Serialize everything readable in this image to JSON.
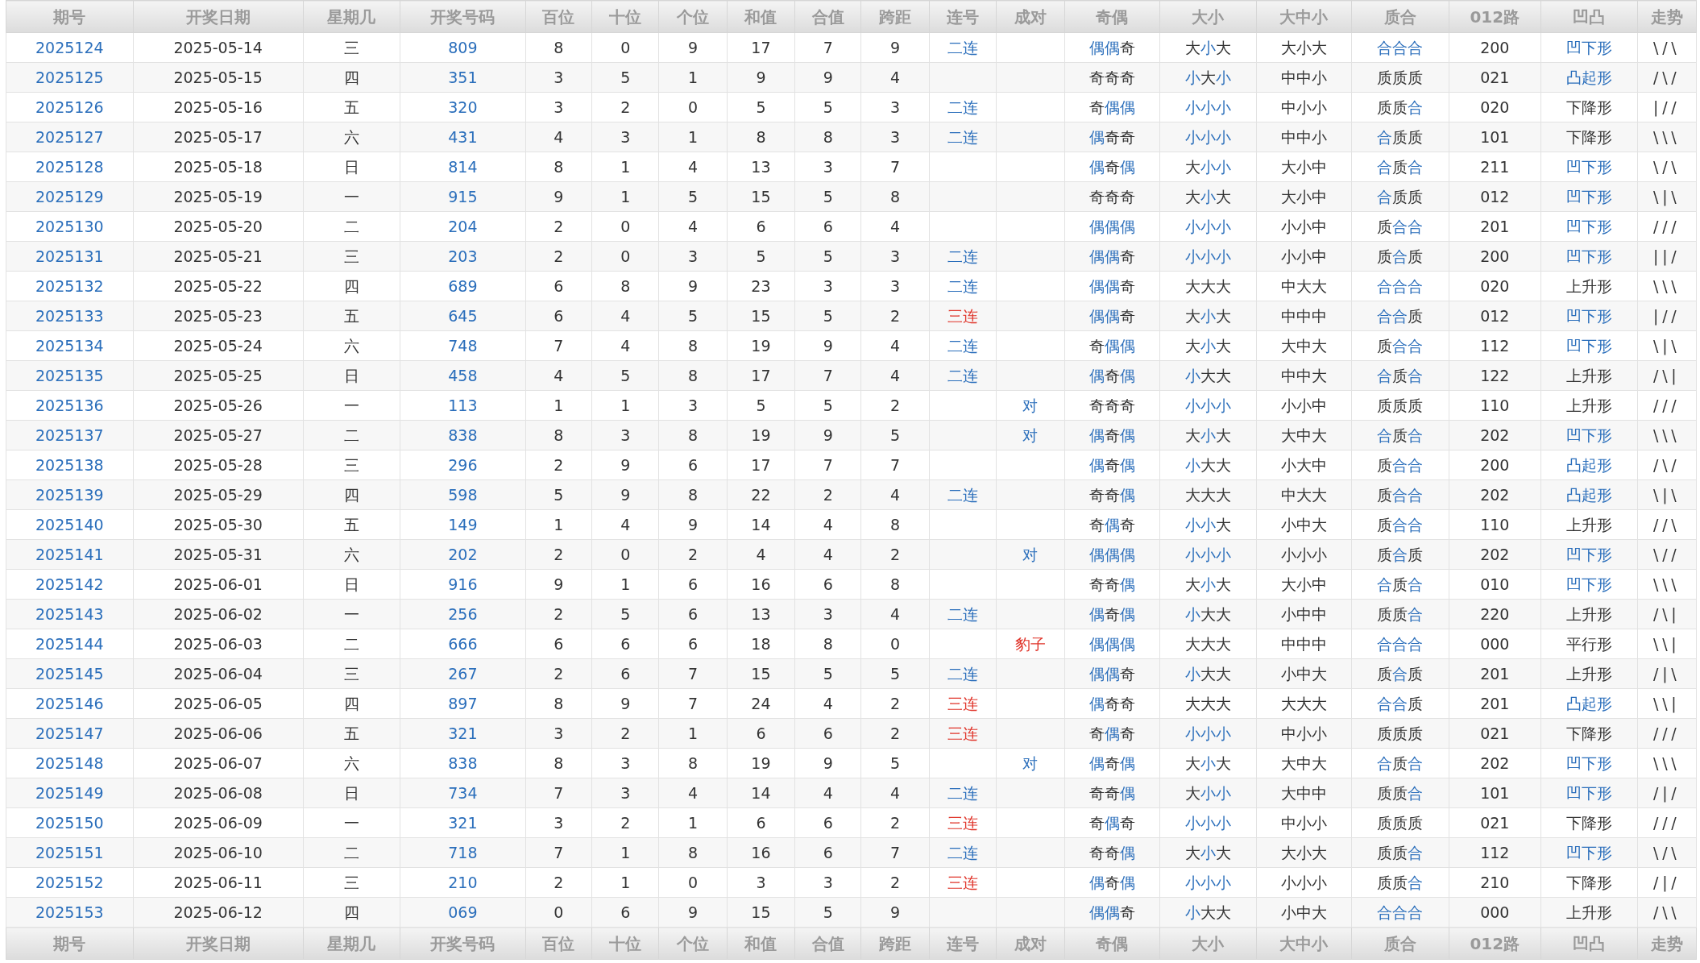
{
  "columns": [
    "期号",
    "开奖日期",
    "星期几",
    "开奖号码",
    "百位",
    "十位",
    "个位",
    "和值",
    "合值",
    "跨距",
    "连号",
    "成对",
    "奇偶",
    "大小",
    "大中小",
    "质合",
    "012路",
    "凹凸",
    "走势"
  ],
  "rows": [
    {
      "issue": "2025124",
      "date": "2025-05-14",
      "weekday": "三",
      "number": "809",
      "hundreds": "8",
      "tens": "0",
      "units": "9",
      "sum": "17",
      "sum_tail": "7",
      "span": "9",
      "consecutive": {
        "text": "二连",
        "color": "#2a6ebb"
      },
      "odd_even": {
        "text": "偶偶奇",
        "marks": [
          true,
          true,
          false
        ]
      },
      "big_small": {
        "text": "大小大",
        "marks": [
          false,
          true,
          false
        ]
      },
      "big_mid_small": "大小大",
      "prime_composite": {
        "text": "合合合",
        "marks": [
          true,
          true,
          true
        ]
      },
      "route_012": "200",
      "shape": {
        "text": "凹下形",
        "highlight": true
      },
      "trend": "\\/\\"
    },
    {
      "issue": "2025125",
      "date": "2025-05-15",
      "weekday": "四",
      "number": "351",
      "hundreds": "3",
      "tens": "5",
      "units": "1",
      "sum": "9",
      "sum_tail": "9",
      "span": "4",
      "odd_even": {
        "text": "奇奇奇",
        "marks": [
          false,
          false,
          false
        ]
      },
      "big_small": {
        "text": "小大小",
        "marks": [
          true,
          false,
          true
        ]
      },
      "big_mid_small": "中中小",
      "prime_composite": {
        "text": "质质质",
        "marks": [
          false,
          false,
          false
        ]
      },
      "route_012": "021",
      "shape": {
        "text": "凸起形",
        "highlight": true
      },
      "trend": "/\\/"
    },
    {
      "issue": "2025126",
      "date": "2025-05-16",
      "weekday": "五",
      "number": "320",
      "hundreds": "3",
      "tens": "2",
      "units": "0",
      "sum": "5",
      "sum_tail": "5",
      "span": "3",
      "consecutive": {
        "text": "二连",
        "color": "#2a6ebb"
      },
      "odd_even": {
        "text": "奇偶偶",
        "marks": [
          false,
          true,
          true
        ]
      },
      "big_small": {
        "text": "小小小",
        "marks": [
          true,
          true,
          true
        ]
      },
      "big_mid_small": "中小小",
      "prime_composite": {
        "text": "质质合",
        "marks": [
          false,
          false,
          true
        ]
      },
      "route_012": "020",
      "shape": {
        "text": "下降形",
        "highlight": false
      },
      "trend": "|//"
    },
    {
      "issue": "2025127",
      "date": "2025-05-17",
      "weekday": "六",
      "number": "431",
      "hundreds": "4",
      "tens": "3",
      "units": "1",
      "sum": "8",
      "sum_tail": "8",
      "span": "3",
      "consecutive": {
        "text": "二连",
        "color": "#2a6ebb"
      },
      "odd_even": {
        "text": "偶奇奇",
        "marks": [
          true,
          false,
          false
        ]
      },
      "big_small": {
        "text": "小小小",
        "marks": [
          true,
          true,
          true
        ]
      },
      "big_mid_small": "中中小",
      "prime_composite": {
        "text": "合质质",
        "marks": [
          true,
          false,
          false
        ]
      },
      "route_012": "101",
      "shape": {
        "text": "下降形",
        "highlight": false
      },
      "trend": "\\\\\\"
    },
    {
      "issue": "2025128",
      "date": "2025-05-18",
      "weekday": "日",
      "number": "814",
      "hundreds": "8",
      "tens": "1",
      "units": "4",
      "sum": "13",
      "sum_tail": "3",
      "span": "7",
      "odd_even": {
        "text": "偶奇偶",
        "marks": [
          true,
          false,
          true
        ]
      },
      "big_small": {
        "text": "大小小",
        "marks": [
          false,
          true,
          true
        ]
      },
      "big_mid_small": "大小中",
      "prime_composite": {
        "text": "合质合",
        "marks": [
          true,
          false,
          true
        ]
      },
      "route_012": "211",
      "shape": {
        "text": "凹下形",
        "highlight": true
      },
      "trend": "\\/\\"
    },
    {
      "issue": "2025129",
      "date": "2025-05-19",
      "weekday": "一",
      "number": "915",
      "hundreds": "9",
      "tens": "1",
      "units": "5",
      "sum": "15",
      "sum_tail": "5",
      "span": "8",
      "odd_even": {
        "text": "奇奇奇",
        "marks": [
          false,
          false,
          false
        ]
      },
      "big_small": {
        "text": "大小大",
        "marks": [
          false,
          true,
          false
        ]
      },
      "big_mid_small": "大小中",
      "prime_composite": {
        "text": "合质质",
        "marks": [
          true,
          false,
          false
        ]
      },
      "route_012": "012",
      "shape": {
        "text": "凹下形",
        "highlight": true
      },
      "trend": "\\|\\"
    },
    {
      "issue": "2025130",
      "date": "2025-05-20",
      "weekday": "二",
      "number": "204",
      "hundreds": "2",
      "tens": "0",
      "units": "4",
      "sum": "6",
      "sum_tail": "6",
      "span": "4",
      "odd_even": {
        "text": "偶偶偶",
        "marks": [
          true,
          true,
          true
        ]
      },
      "big_small": {
        "text": "小小小",
        "marks": [
          true,
          true,
          true
        ]
      },
      "big_mid_small": "小小中",
      "prime_composite": {
        "text": "质合合",
        "marks": [
          false,
          true,
          true
        ]
      },
      "route_012": "201",
      "shape": {
        "text": "凹下形",
        "highlight": true
      },
      "trend": "///"
    },
    {
      "issue": "2025131",
      "date": "2025-05-21",
      "weekday": "三",
      "number": "203",
      "hundreds": "2",
      "tens": "0",
      "units": "3",
      "sum": "5",
      "sum_tail": "5",
      "span": "3",
      "consecutive": {
        "text": "二连",
        "color": "#2a6ebb"
      },
      "odd_even": {
        "text": "偶偶奇",
        "marks": [
          true,
          true,
          false
        ]
      },
      "big_small": {
        "text": "小小小",
        "marks": [
          true,
          true,
          true
        ]
      },
      "big_mid_small": "小小中",
      "prime_composite": {
        "text": "质合质",
        "marks": [
          false,
          true,
          false
        ]
      },
      "route_012": "200",
      "shape": {
        "text": "凹下形",
        "highlight": true
      },
      "trend": "||/"
    },
    {
      "issue": "2025132",
      "date": "2025-05-22",
      "weekday": "四",
      "number": "689",
      "hundreds": "6",
      "tens": "8",
      "units": "9",
      "sum": "23",
      "sum_tail": "3",
      "span": "3",
      "consecutive": {
        "text": "二连",
        "color": "#2a6ebb"
      },
      "odd_even": {
        "text": "偶偶奇",
        "marks": [
          true,
          true,
          false
        ]
      },
      "big_small": {
        "text": "大大大",
        "marks": [
          false,
          false,
          false
        ]
      },
      "big_mid_small": "中大大",
      "prime_composite": {
        "text": "合合合",
        "marks": [
          true,
          true,
          true
        ]
      },
      "route_012": "020",
      "shape": {
        "text": "上升形",
        "highlight": false
      },
      "trend": "\\\\\\"
    },
    {
      "issue": "2025133",
      "date": "2025-05-23",
      "weekday": "五",
      "number": "645",
      "hundreds": "6",
      "tens": "4",
      "units": "5",
      "sum": "15",
      "sum_tail": "5",
      "span": "2",
      "consecutive": {
        "text": "三连",
        "color": "#e0362c"
      },
      "odd_even": {
        "text": "偶偶奇",
        "marks": [
          true,
          true,
          false
        ]
      },
      "big_small": {
        "text": "大小大",
        "marks": [
          false,
          true,
          false
        ]
      },
      "big_mid_small": "中中中",
      "prime_composite": {
        "text": "合合质",
        "marks": [
          true,
          true,
          false
        ]
      },
      "route_012": "012",
      "shape": {
        "text": "凹下形",
        "highlight": true
      },
      "trend": "|//"
    },
    {
      "issue": "2025134",
      "date": "2025-05-24",
      "weekday": "六",
      "number": "748",
      "hundreds": "7",
      "tens": "4",
      "units": "8",
      "sum": "19",
      "sum_tail": "9",
      "span": "4",
      "consecutive": {
        "text": "二连",
        "color": "#2a6ebb"
      },
      "odd_even": {
        "text": "奇偶偶",
        "marks": [
          false,
          true,
          true
        ]
      },
      "big_small": {
        "text": "大小大",
        "marks": [
          false,
          true,
          false
        ]
      },
      "big_mid_small": "大中大",
      "prime_composite": {
        "text": "质合合",
        "marks": [
          false,
          true,
          true
        ]
      },
      "route_012": "112",
      "shape": {
        "text": "凹下形",
        "highlight": true
      },
      "trend": "\\|\\"
    },
    {
      "issue": "2025135",
      "date": "2025-05-25",
      "weekday": "日",
      "number": "458",
      "hundreds": "4",
      "tens": "5",
      "units": "8",
      "sum": "17",
      "sum_tail": "7",
      "span": "4",
      "consecutive": {
        "text": "二连",
        "color": "#2a6ebb"
      },
      "odd_even": {
        "text": "偶奇偶",
        "marks": [
          true,
          false,
          true
        ]
      },
      "big_small": {
        "text": "小大大",
        "marks": [
          true,
          false,
          false
        ]
      },
      "big_mid_small": "中中大",
      "prime_composite": {
        "text": "合质合",
        "marks": [
          true,
          false,
          true
        ]
      },
      "route_012": "122",
      "shape": {
        "text": "上升形",
        "highlight": false
      },
      "trend": "/\\|"
    },
    {
      "issue": "2025136",
      "date": "2025-05-26",
      "weekday": "一",
      "number": "113",
      "hundreds": "1",
      "tens": "1",
      "units": "3",
      "sum": "5",
      "sum_tail": "5",
      "span": "2",
      "pair": {
        "text": "对",
        "color": "#2a6ebb"
      },
      "odd_even": {
        "text": "奇奇奇",
        "marks": [
          false,
          false,
          false
        ]
      },
      "big_small": {
        "text": "小小小",
        "marks": [
          true,
          true,
          true
        ]
      },
      "big_mid_small": "小小中",
      "prime_composite": {
        "text": "质质质",
        "marks": [
          false,
          false,
          false
        ]
      },
      "route_012": "110",
      "shape": {
        "text": "上升形",
        "highlight": false
      },
      "trend": "///"
    },
    {
      "issue": "2025137",
      "date": "2025-05-27",
      "weekday": "二",
      "number": "838",
      "hundreds": "8",
      "tens": "3",
      "units": "8",
      "sum": "19",
      "sum_tail": "9",
      "span": "5",
      "pair": {
        "text": "对",
        "color": "#2a6ebb"
      },
      "odd_even": {
        "text": "偶奇偶",
        "marks": [
          true,
          false,
          true
        ]
      },
      "big_small": {
        "text": "大小大",
        "marks": [
          false,
          true,
          false
        ]
      },
      "big_mid_small": "大中大",
      "prime_composite": {
        "text": "合质合",
        "marks": [
          true,
          false,
          true
        ]
      },
      "route_012": "202",
      "shape": {
        "text": "凹下形",
        "highlight": true
      },
      "trend": "\\\\\\"
    },
    {
      "issue": "2025138",
      "date": "2025-05-28",
      "weekday": "三",
      "number": "296",
      "hundreds": "2",
      "tens": "9",
      "units": "6",
      "sum": "17",
      "sum_tail": "7",
      "span": "7",
      "odd_even": {
        "text": "偶奇偶",
        "marks": [
          true,
          false,
          true
        ]
      },
      "big_small": {
        "text": "小大大",
        "marks": [
          true,
          false,
          false
        ]
      },
      "big_mid_small": "小大中",
      "prime_composite": {
        "text": "质合合",
        "marks": [
          false,
          true,
          true
        ]
      },
      "route_012": "200",
      "shape": {
        "text": "凸起形",
        "highlight": true
      },
      "trend": "/\\/"
    },
    {
      "issue": "2025139",
      "date": "2025-05-29",
      "weekday": "四",
      "number": "598",
      "hundreds": "5",
      "tens": "9",
      "units": "8",
      "sum": "22",
      "sum_tail": "2",
      "span": "4",
      "consecutive": {
        "text": "二连",
        "color": "#2a6ebb"
      },
      "odd_even": {
        "text": "奇奇偶",
        "marks": [
          false,
          false,
          true
        ]
      },
      "big_small": {
        "text": "大大大",
        "marks": [
          false,
          false,
          false
        ]
      },
      "big_mid_small": "中大大",
      "prime_composite": {
        "text": "质合合",
        "marks": [
          false,
          true,
          true
        ]
      },
      "route_012": "202",
      "shape": {
        "text": "凸起形",
        "highlight": true
      },
      "trend": "\\|\\"
    },
    {
      "issue": "2025140",
      "date": "2025-05-30",
      "weekday": "五",
      "number": "149",
      "hundreds": "1",
      "tens": "4",
      "units": "9",
      "sum": "14",
      "sum_tail": "4",
      "span": "8",
      "odd_even": {
        "text": "奇偶奇",
        "marks": [
          false,
          true,
          false
        ]
      },
      "big_small": {
        "text": "小小大",
        "marks": [
          true,
          true,
          false
        ]
      },
      "big_mid_small": "小中大",
      "prime_composite": {
        "text": "质合合",
        "marks": [
          false,
          true,
          true
        ]
      },
      "route_012": "110",
      "shape": {
        "text": "上升形",
        "highlight": false
      },
      "trend": "//\\"
    },
    {
      "issue": "2025141",
      "date": "2025-05-31",
      "weekday": "六",
      "number": "202",
      "hundreds": "2",
      "tens": "0",
      "units": "2",
      "sum": "4",
      "sum_tail": "4",
      "span": "2",
      "pair": {
        "text": "对",
        "color": "#2a6ebb"
      },
      "odd_even": {
        "text": "偶偶偶",
        "marks": [
          true,
          true,
          true
        ]
      },
      "big_small": {
        "text": "小小小",
        "marks": [
          true,
          true,
          true
        ]
      },
      "big_mid_small": "小小小",
      "prime_composite": {
        "text": "质合质",
        "marks": [
          false,
          true,
          false
        ]
      },
      "route_012": "202",
      "shape": {
        "text": "凹下形",
        "highlight": true
      },
      "trend": "\\//"
    },
    {
      "issue": "2025142",
      "date": "2025-06-01",
      "weekday": "日",
      "number": "916",
      "hundreds": "9",
      "tens": "1",
      "units": "6",
      "sum": "16",
      "sum_tail": "6",
      "span": "8",
      "odd_even": {
        "text": "奇奇偶",
        "marks": [
          false,
          false,
          true
        ]
      },
      "big_small": {
        "text": "大小大",
        "marks": [
          false,
          true,
          false
        ]
      },
      "big_mid_small": "大小中",
      "prime_composite": {
        "text": "合质合",
        "marks": [
          true,
          false,
          true
        ]
      },
      "route_012": "010",
      "shape": {
        "text": "凹下形",
        "highlight": true
      },
      "trend": "\\\\\\"
    },
    {
      "issue": "2025143",
      "date": "2025-06-02",
      "weekday": "一",
      "number": "256",
      "hundreds": "2",
      "tens": "5",
      "units": "6",
      "sum": "13",
      "sum_tail": "3",
      "span": "4",
      "consecutive": {
        "text": "二连",
        "color": "#2a6ebb"
      },
      "odd_even": {
        "text": "偶奇偶",
        "marks": [
          true,
          false,
          true
        ]
      },
      "big_small": {
        "text": "小大大",
        "marks": [
          true,
          false,
          false
        ]
      },
      "big_mid_small": "小中中",
      "prime_composite": {
        "text": "质质合",
        "marks": [
          false,
          false,
          true
        ]
      },
      "route_012": "220",
      "shape": {
        "text": "上升形",
        "highlight": false
      },
      "trend": "/\\|"
    },
    {
      "issue": "2025144",
      "date": "2025-06-03",
      "weekday": "二",
      "number": "666",
      "hundreds": "6",
      "tens": "6",
      "units": "6",
      "sum": "18",
      "sum_tail": "8",
      "span": "0",
      "pair": {
        "text": "豹子",
        "color": "#e0362c"
      },
      "odd_even": {
        "text": "偶偶偶",
        "marks": [
          true,
          true,
          true
        ]
      },
      "big_small": {
        "text": "大大大",
        "marks": [
          false,
          false,
          false
        ]
      },
      "big_mid_small": "中中中",
      "prime_composite": {
        "text": "合合合",
        "marks": [
          true,
          true,
          true
        ]
      },
      "route_012": "000",
      "shape": {
        "text": "平行形",
        "highlight": false
      },
      "trend": "\\\\|"
    },
    {
      "issue": "2025145",
      "date": "2025-06-04",
      "weekday": "三",
      "number": "267",
      "hundreds": "2",
      "tens": "6",
      "units": "7",
      "sum": "15",
      "sum_tail": "5",
      "span": "5",
      "consecutive": {
        "text": "二连",
        "color": "#2a6ebb"
      },
      "odd_even": {
        "text": "偶偶奇",
        "marks": [
          true,
          true,
          false
        ]
      },
      "big_small": {
        "text": "小大大",
        "marks": [
          true,
          false,
          false
        ]
      },
      "big_mid_small": "小中大",
      "prime_composite": {
        "text": "质合质",
        "marks": [
          false,
          true,
          false
        ]
      },
      "route_012": "201",
      "shape": {
        "text": "上升形",
        "highlight": false
      },
      "trend": "/|\\"
    },
    {
      "issue": "2025146",
      "date": "2025-06-05",
      "weekday": "四",
      "number": "897",
      "hundreds": "8",
      "tens": "9",
      "units": "7",
      "sum": "24",
      "sum_tail": "4",
      "span": "2",
      "consecutive": {
        "text": "三连",
        "color": "#e0362c"
      },
      "odd_even": {
        "text": "偶奇奇",
        "marks": [
          true,
          false,
          false
        ]
      },
      "big_small": {
        "text": "大大大",
        "marks": [
          false,
          false,
          false
        ]
      },
      "big_mid_small": "大大大",
      "prime_composite": {
        "text": "合合质",
        "marks": [
          true,
          true,
          false
        ]
      },
      "route_012": "201",
      "shape": {
        "text": "凸起形",
        "highlight": true
      },
      "trend": "\\\\|"
    },
    {
      "issue": "2025147",
      "date": "2025-06-06",
      "weekday": "五",
      "number": "321",
      "hundreds": "3",
      "tens": "2",
      "units": "1",
      "sum": "6",
      "sum_tail": "6",
      "span": "2",
      "consecutive": {
        "text": "三连",
        "color": "#e0362c"
      },
      "odd_even": {
        "text": "奇偶奇",
        "marks": [
          false,
          true,
          false
        ]
      },
      "big_small": {
        "text": "小小小",
        "marks": [
          true,
          true,
          true
        ]
      },
      "big_mid_small": "中小小",
      "prime_composite": {
        "text": "质质质",
        "marks": [
          false,
          false,
          false
        ]
      },
      "route_012": "021",
      "shape": {
        "text": "下降形",
        "highlight": false
      },
      "trend": "///"
    },
    {
      "issue": "2025148",
      "date": "2025-06-07",
      "weekday": "六",
      "number": "838",
      "hundreds": "8",
      "tens": "3",
      "units": "8",
      "sum": "19",
      "sum_tail": "9",
      "span": "5",
      "pair": {
        "text": "对",
        "color": "#2a6ebb"
      },
      "odd_even": {
        "text": "偶奇偶",
        "marks": [
          true,
          false,
          true
        ]
      },
      "big_small": {
        "text": "大小大",
        "marks": [
          false,
          true,
          false
        ]
      },
      "big_mid_small": "大中大",
      "prime_composite": {
        "text": "合质合",
        "marks": [
          true,
          false,
          true
        ]
      },
      "route_012": "202",
      "shape": {
        "text": "凹下形",
        "highlight": true
      },
      "trend": "\\\\\\"
    },
    {
      "issue": "2025149",
      "date": "2025-06-08",
      "weekday": "日",
      "number": "734",
      "hundreds": "7",
      "tens": "3",
      "units": "4",
      "sum": "14",
      "sum_tail": "4",
      "span": "4",
      "consecutive": {
        "text": "二连",
        "color": "#2a6ebb"
      },
      "odd_even": {
        "text": "奇奇偶",
        "marks": [
          false,
          false,
          true
        ]
      },
      "big_small": {
        "text": "大小小",
        "marks": [
          false,
          true,
          true
        ]
      },
      "big_mid_small": "大中中",
      "prime_composite": {
        "text": "质质合",
        "marks": [
          false,
          false,
          true
        ]
      },
      "route_012": "101",
      "shape": {
        "text": "凹下形",
        "highlight": true
      },
      "trend": "/|/"
    },
    {
      "issue": "2025150",
      "date": "2025-06-09",
      "weekday": "一",
      "number": "321",
      "hundreds": "3",
      "tens": "2",
      "units": "1",
      "sum": "6",
      "sum_tail": "6",
      "span": "2",
      "consecutive": {
        "text": "三连",
        "color": "#e0362c"
      },
      "odd_even": {
        "text": "奇偶奇",
        "marks": [
          false,
          true,
          false
        ]
      },
      "big_small": {
        "text": "小小小",
        "marks": [
          true,
          true,
          true
        ]
      },
      "big_mid_small": "中小小",
      "prime_composite": {
        "text": "质质质",
        "marks": [
          false,
          false,
          false
        ]
      },
      "route_012": "021",
      "shape": {
        "text": "下降形",
        "highlight": false
      },
      "trend": "///"
    },
    {
      "issue": "2025151",
      "date": "2025-06-10",
      "weekday": "二",
      "number": "718",
      "hundreds": "7",
      "tens": "1",
      "units": "8",
      "sum": "16",
      "sum_tail": "6",
      "span": "7",
      "consecutive": {
        "text": "二连",
        "color": "#2a6ebb"
      },
      "odd_even": {
        "text": "奇奇偶",
        "marks": [
          false,
          false,
          true
        ]
      },
      "big_small": {
        "text": "大小大",
        "marks": [
          false,
          true,
          false
        ]
      },
      "big_mid_small": "大小大",
      "prime_composite": {
        "text": "质质合",
        "marks": [
          false,
          false,
          true
        ]
      },
      "route_012": "112",
      "shape": {
        "text": "凹下形",
        "highlight": true
      },
      "trend": "\\/\\"
    },
    {
      "issue": "2025152",
      "date": "2025-06-11",
      "weekday": "三",
      "number": "210",
      "hundreds": "2",
      "tens": "1",
      "units": "0",
      "sum": "3",
      "sum_tail": "3",
      "span": "2",
      "consecutive": {
        "text": "三连",
        "color": "#e0362c"
      },
      "odd_even": {
        "text": "偶奇偶",
        "marks": [
          true,
          false,
          true
        ]
      },
      "big_small": {
        "text": "小小小",
        "marks": [
          true,
          true,
          true
        ]
      },
      "big_mid_small": "小小小",
      "prime_composite": {
        "text": "质质合",
        "marks": [
          false,
          false,
          true
        ]
      },
      "route_012": "210",
      "shape": {
        "text": "下降形",
        "highlight": false
      },
      "trend": "/|/"
    },
    {
      "issue": "2025153",
      "date": "2025-06-12",
      "weekday": "四",
      "number": "069",
      "hundreds": "0",
      "tens": "6",
      "units": "9",
      "sum": "15",
      "sum_tail": "5",
      "span": "9",
      "odd_even": {
        "text": "偶偶奇",
        "marks": [
          true,
          true,
          false
        ]
      },
      "big_small": {
        "text": "小大大",
        "marks": [
          true,
          false,
          false
        ]
      },
      "big_mid_small": "小中大",
      "prime_composite": {
        "text": "合合合",
        "marks": [
          true,
          true,
          true
        ]
      },
      "route_012": "000",
      "shape": {
        "text": "上升形",
        "highlight": false
      },
      "trend": "/\\\\"
    }
  ],
  "footer_columns": [
    "期号",
    "开奖日期",
    "星期几",
    "开奖号码",
    "百位",
    "十位",
    "个位",
    "和值",
    "合值",
    "跨距",
    "连号",
    "成对",
    "奇偶",
    "大小",
    "大中小",
    "质合",
    "012路",
    "凹凸",
    "走势"
  ]
}
